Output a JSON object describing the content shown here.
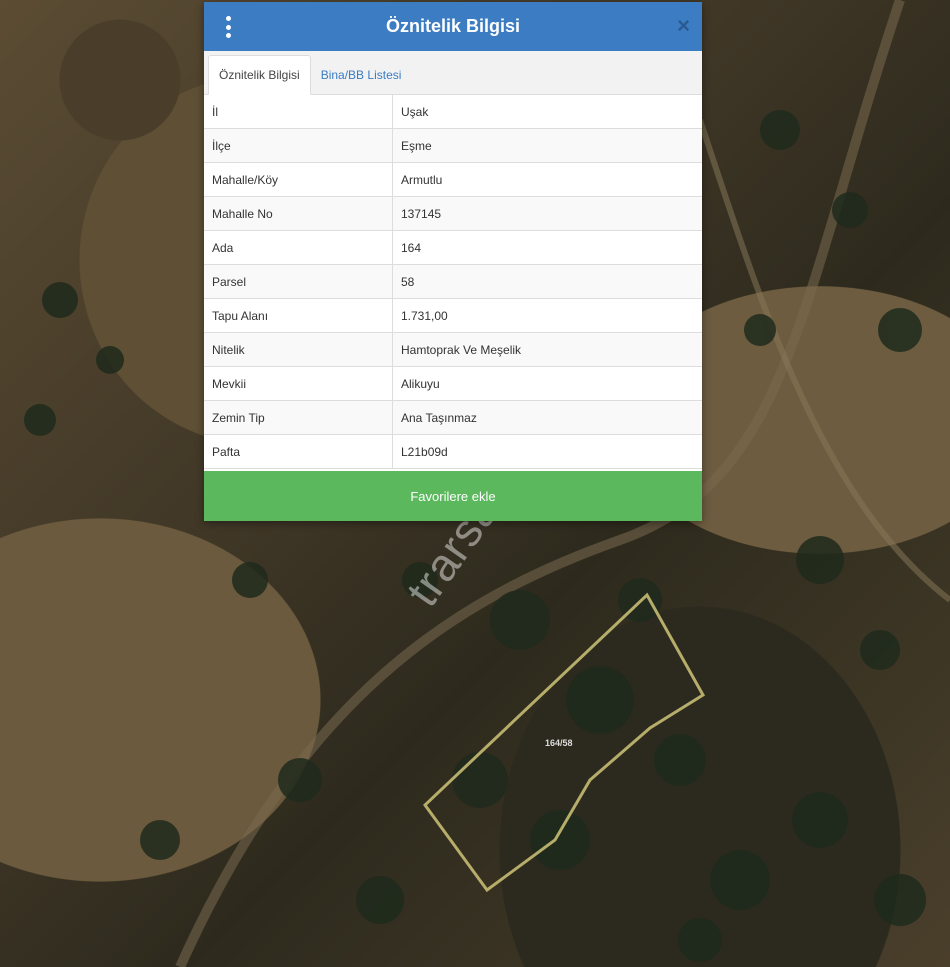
{
  "dialog": {
    "title": "Öznitelik Bilgisi",
    "close_label": "×"
  },
  "tabs": [
    {
      "label": "Öznitelik Bilgisi",
      "active": true
    },
    {
      "label": "Bina/BB Listesi",
      "active": false
    }
  ],
  "attributes": [
    {
      "key": "İl",
      "value": "Uşak"
    },
    {
      "key": "İlçe",
      "value": "Eşme"
    },
    {
      "key": "Mahalle/Köy",
      "value": "Armutlu"
    },
    {
      "key": "Mahalle No",
      "value": "137145"
    },
    {
      "key": "Ada",
      "value": "164"
    },
    {
      "key": "Parsel",
      "value": "58"
    },
    {
      "key": "Tapu Alanı",
      "value": "1.731,00"
    },
    {
      "key": "Nitelik",
      "value": "Hamtoprak Ve Meşelik"
    },
    {
      "key": "Mevkii",
      "value": "Alikuyu"
    },
    {
      "key": "Zemin Tip",
      "value": "Ana Taşınmaz"
    },
    {
      "key": "Pafta",
      "value": "L21b09d"
    }
  ],
  "favorite_button": "Favorilere ekle",
  "map": {
    "parcel_label": "164/58",
    "watermark": "trarsa.com.tr"
  },
  "colors": {
    "header": "#3b7cc2",
    "button": "#5cb85c",
    "parcel_outline": "#b7ad6a"
  }
}
